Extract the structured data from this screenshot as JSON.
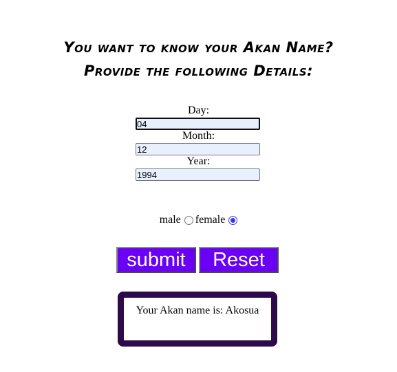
{
  "heading": {
    "line1": "You want to know your Akan Name?",
    "line2": "Provide the following Details:"
  },
  "form": {
    "day": {
      "label": "Day:",
      "value": "04"
    },
    "month": {
      "label": "Month:",
      "value": "12"
    },
    "year": {
      "label": "Year:",
      "value": "1994"
    }
  },
  "gender": {
    "male_label": "male",
    "female_label": "female",
    "selected": "female"
  },
  "buttons": {
    "submit_label": "submit",
    "reset_label": "Reset"
  },
  "result": {
    "text": "Your Akan name is: Akosua"
  },
  "colors": {
    "button_bg": "#6a00f4",
    "result_border": "#2e0a4a",
    "input_bg": "#e8f0fe",
    "radio_checked": "#3535ee"
  }
}
